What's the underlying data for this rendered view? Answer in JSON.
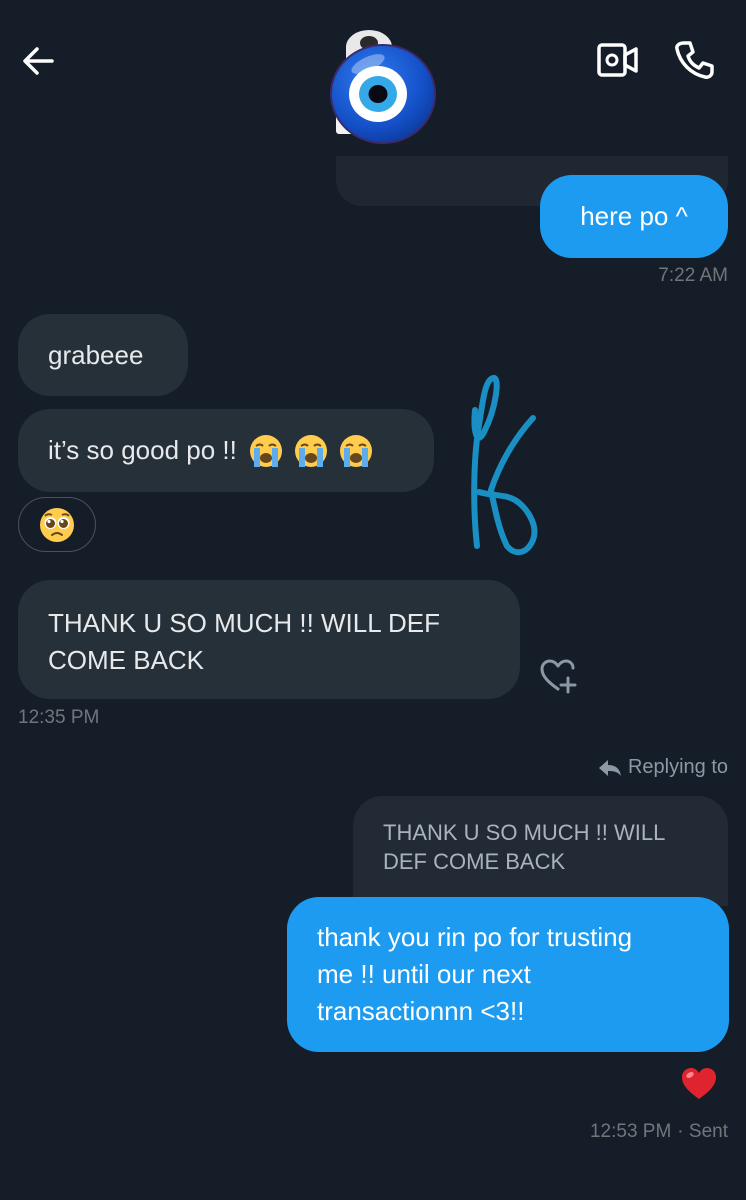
{
  "header": {
    "back_icon": "arrow-left-icon",
    "video_icon": "video-camera-icon",
    "phone_icon": "phone-icon",
    "avatar": "evil-eye-emoji"
  },
  "messages": {
    "here": {
      "text": "here po ^",
      "time": "7:22 AM"
    },
    "grab": {
      "text": "grabeee"
    },
    "good": {
      "text": "it’s so good po !!"
    },
    "reaction_emoji": "pleading-face-emoji",
    "thank": {
      "line1": "THANK U SO MUCH !! WILL DEF",
      "line2": "COME BACK",
      "time": "12:35 PM"
    },
    "reply": {
      "replying_label": "Replying to",
      "quoted_line1": "THANK U SO MUCH !! WILL",
      "quoted_line2": "DEF COME BACK",
      "line1": "thank you rin po for trusting",
      "line2": "me !! until our next",
      "line3": "transactionnn <3!!",
      "time": "12:53 PM",
      "status": "· Sent"
    }
  },
  "colors": {
    "background": "#151d28",
    "incoming_bubble": "#263039",
    "outgoing_bubble": "#1d9bf0",
    "muted_text": "#71767b",
    "signature": "#1a8fc4"
  }
}
